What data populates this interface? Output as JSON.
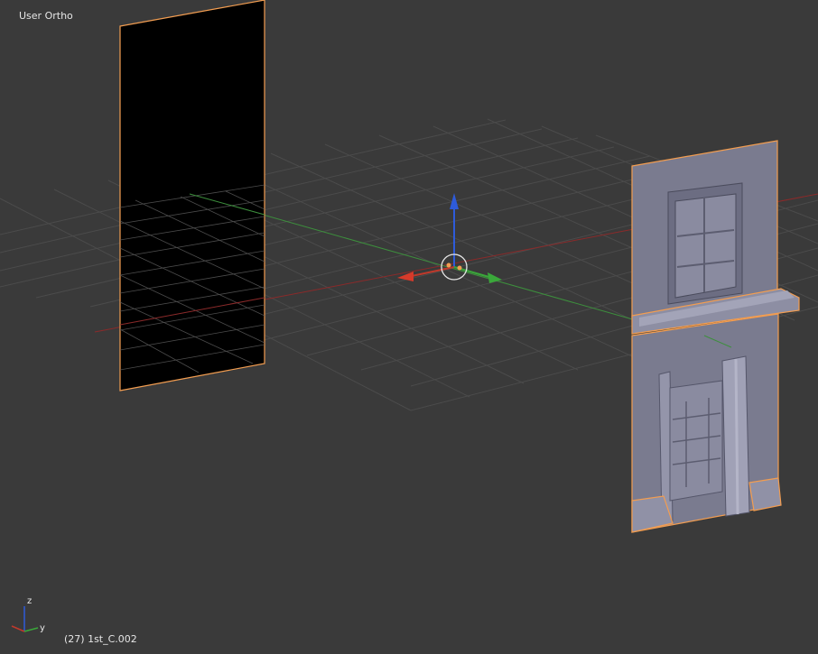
{
  "viewport": {
    "view_label": "User Ortho",
    "object_info": "(27) 1st_C.002",
    "background_color": "#3a3a3a",
    "grid_color": "#4a4a4a",
    "selection_outline_color": "#f29d51"
  },
  "gizmo": {
    "z_label": "z",
    "y_label": "y",
    "x_color": "#c0392b",
    "y_color": "#3aa83a",
    "z_color": "#2e5bd9"
  },
  "objects": [
    {
      "name": "black-plane",
      "selected": true
    },
    {
      "name": "facade-mesh",
      "selected": true
    }
  ]
}
